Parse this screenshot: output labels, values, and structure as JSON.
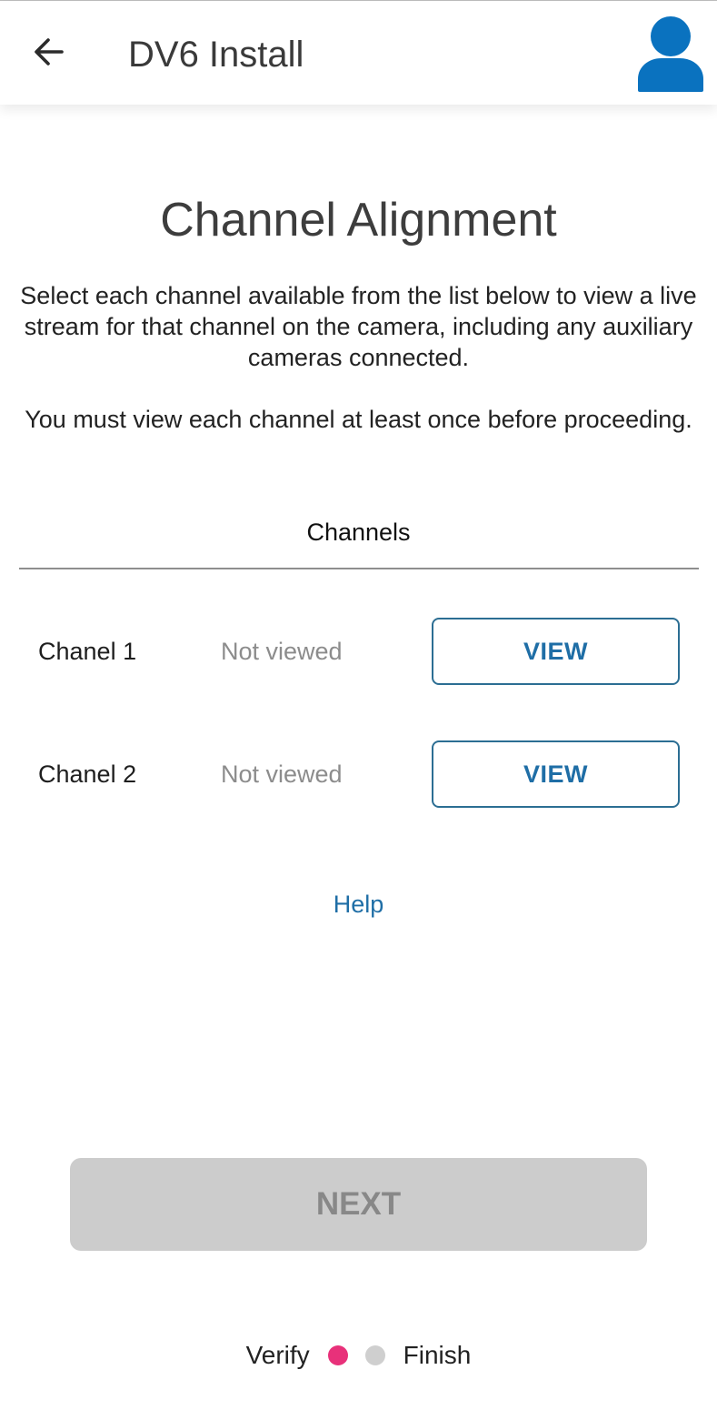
{
  "app_bar": {
    "title": "DV6 Install",
    "back_icon": "arrow-left-icon",
    "profile_icon": "user-profile-icon",
    "profile_color": "#0a72bf"
  },
  "page": {
    "title": "Channel Alignment",
    "instruction_1": "Select each channel available from the list below to view a live stream for that channel on the camera, including any auxiliary cameras connected.",
    "instruction_2": "You must view each channel at least once before proceeding."
  },
  "channels": {
    "header": "Channels",
    "items": [
      {
        "name": "Chanel 1",
        "status": "Not viewed",
        "button_label": "VIEW"
      },
      {
        "name": "Chanel 2",
        "status": "Not viewed",
        "button_label": "VIEW"
      }
    ]
  },
  "help": {
    "label": "Help"
  },
  "next": {
    "label": "NEXT",
    "enabled": false
  },
  "stepper": {
    "left_label": "Verify",
    "right_label": "Finish",
    "active_color": "#e8317a",
    "inactive_color": "#cfcfcf"
  },
  "colors": {
    "accent": "#1f6ea6",
    "button_border": "#2c6e93",
    "disabled_bg": "#cccccc",
    "disabled_text": "#888888"
  }
}
